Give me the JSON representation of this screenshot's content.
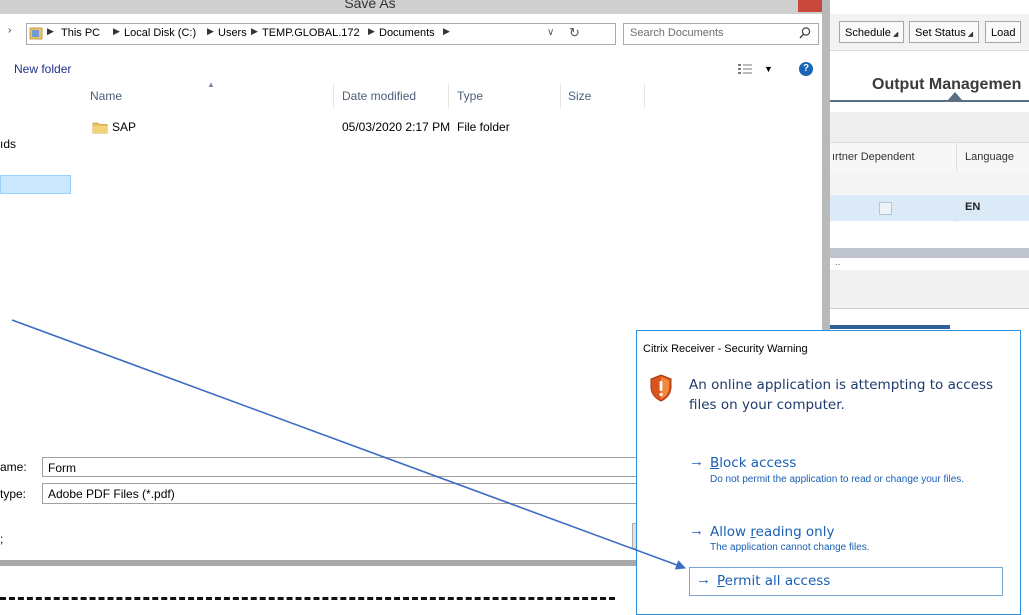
{
  "save_dialog": {
    "title": "Save As",
    "breadcrumbs": [
      "This PC",
      "Local Disk (C:)",
      "Users",
      "TEMP.GLOBAL.172",
      "Documents"
    ],
    "search_placeholder": "Search Documents",
    "toolbar": {
      "new_folder": "New folder"
    },
    "columns": {
      "name": "Name",
      "date_modified": "Date modified",
      "type": "Type",
      "size": "Size"
    },
    "files": [
      {
        "name": "SAP",
        "date_modified": "05/03/2020 2:17 PM",
        "type": "File folder",
        "size": ""
      }
    ],
    "nav_fragment": "ıds",
    "file_name_label": "ame:",
    "file_name_value": "Form",
    "save_type_label": "type:",
    "save_type_value": "Adobe PDF Files (*.pdf)",
    "hide_folders_fragment": ";"
  },
  "sap_app": {
    "toolbar_buttons": [
      "Schedule",
      "Set Status",
      "Load"
    ],
    "section_title": "Output Managemen",
    "columns": [
      "ırtner Dependent",
      "Language"
    ],
    "row": {
      "language": "EN"
    },
    "ellipsis": ".."
  },
  "citrix_warning": {
    "title": "Citrix Receiver - Security Warning",
    "message": "An online application is attempting to access files on your computer.",
    "options": [
      {
        "arrow": "→",
        "mnemonic": "B",
        "label_rest": "lock access",
        "description": "Do not permit the application to read or change your files."
      },
      {
        "arrow": "→",
        "label_pre": "Allow ",
        "mnemonic": "r",
        "label_rest": "eading only",
        "description": "The application cannot change files."
      },
      {
        "arrow": "→",
        "mnemonic": "P",
        "label_rest": "ermit all access"
      }
    ]
  },
  "colors": {
    "accent_blue": "#1a5fb4",
    "callout_line": "#3b6cc1",
    "selection_blue": "#cce8ff"
  }
}
